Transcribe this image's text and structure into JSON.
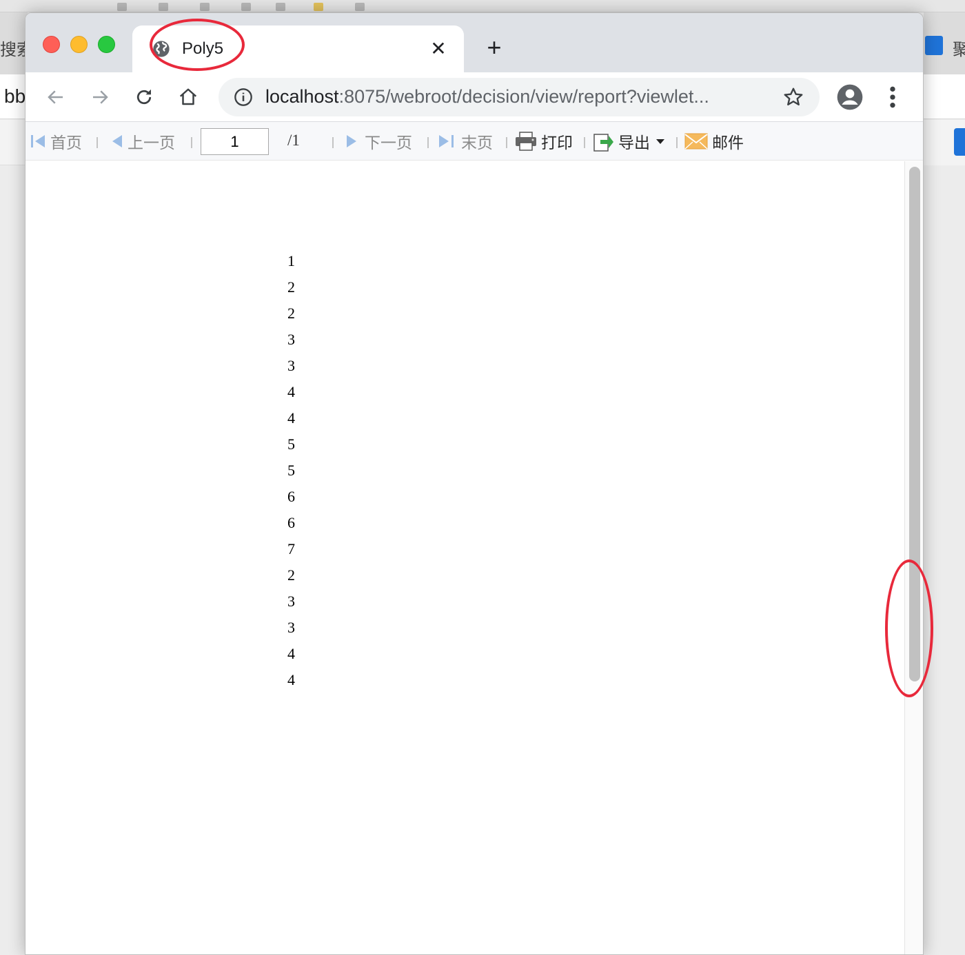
{
  "background": {
    "left_tab_text": "搜索",
    "left_bar_text": "bb",
    "right_tab_text": "聚"
  },
  "browser": {
    "tab": {
      "title": "Poly5",
      "favicon": "globe-icon",
      "close_glyph": "✕"
    },
    "new_tab_glyph": "+",
    "omnibox": {
      "host": "localhost",
      "path": ":8075/webroot/decision/view/report?viewlet..."
    }
  },
  "report_toolbar": {
    "first": "首页",
    "prev": "上一页",
    "page_value": "1",
    "page_total": "/1",
    "next": "下一页",
    "last": "末页",
    "print": "打印",
    "export": "导出",
    "email": "邮件"
  },
  "report": {
    "column_values": [
      "1",
      "2",
      "2",
      "3",
      "3",
      "4",
      "4",
      "5",
      "5",
      "6",
      "6",
      "7",
      "2",
      "3",
      "3",
      "4",
      "4"
    ]
  },
  "colors": {
    "annotation": "#e8293b",
    "tabstrip": "#dee1e6",
    "disabled_nav": "#9bbde6"
  }
}
